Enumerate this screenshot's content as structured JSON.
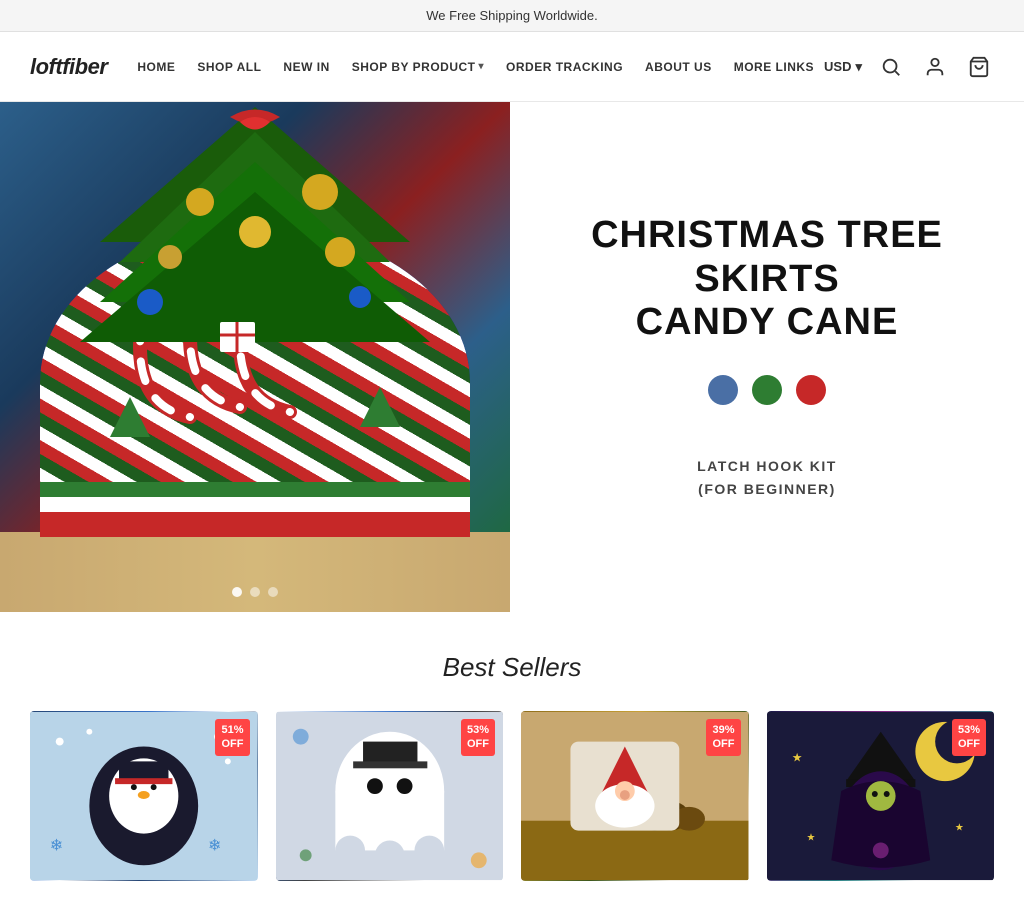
{
  "banner": {
    "text": "We Free Shipping Worldwide."
  },
  "header": {
    "logo": "loftfiber",
    "nav": [
      {
        "label": "HOME",
        "dropdown": false
      },
      {
        "label": "SHOP ALL",
        "dropdown": false
      },
      {
        "label": "NEW IN",
        "dropdown": false
      },
      {
        "label": "SHOP BY PRODUCT",
        "dropdown": true
      },
      {
        "label": "ORDER TRACKING",
        "dropdown": false
      },
      {
        "label": "ABOUT US",
        "dropdown": false
      },
      {
        "label": "More Links",
        "dropdown": false
      }
    ],
    "currency": "USD",
    "currency_arrow": "▾"
  },
  "hero": {
    "title_line1": "CHRISTMAS TREE SKIRTS",
    "title_line2": "CANDY CANE",
    "subtitle_line1": "LATCH HOOK KIT",
    "subtitle_line2": "(FOR BEGINNER)",
    "swatches": [
      {
        "color": "#4a6fa5",
        "label": "Blue"
      },
      {
        "color": "#2e7d32",
        "label": "Green"
      },
      {
        "color": "#c62828",
        "label": "Red"
      }
    ],
    "dots": [
      {
        "active": true
      },
      {
        "active": false
      },
      {
        "active": false
      }
    ]
  },
  "best_sellers": {
    "title": "Best Sellers",
    "products": [
      {
        "badge_percent": "51%",
        "badge_label": "OFF",
        "alt": "Penguin pillow"
      },
      {
        "badge_percent": "53%",
        "badge_label": "OFF",
        "alt": "Ghost pillow"
      },
      {
        "badge_percent": "39%",
        "badge_label": "OFF",
        "alt": "Christmas gnome pillow"
      },
      {
        "badge_percent": "53%",
        "badge_label": "OFF",
        "alt": "Witch pillow"
      }
    ]
  },
  "icons": {
    "search": "🔍",
    "account": "👤",
    "cart": "🛒",
    "dropdown_arrow": "▾"
  }
}
